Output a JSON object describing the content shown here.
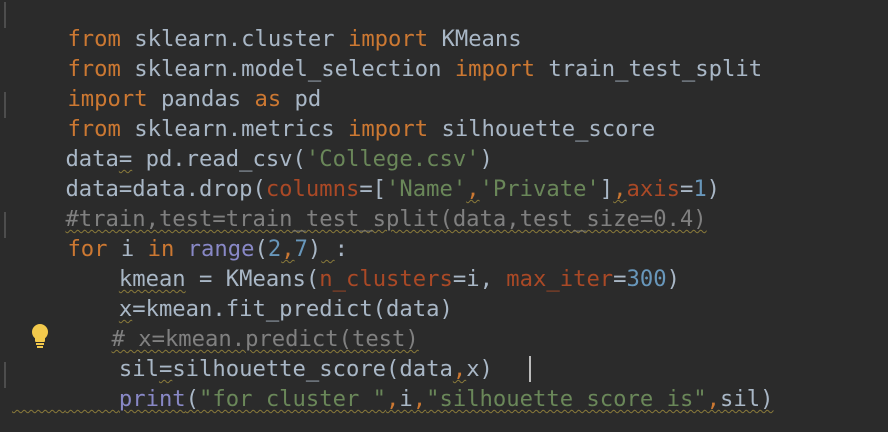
{
  "editor": {
    "lines": {
      "l1": {
        "kw1": "from",
        "mod": " sklearn.cluster ",
        "kw2": "import",
        "name": " KMeans"
      },
      "l2": {
        "kw1": "from",
        "mod": " sklearn.model_selection ",
        "kw2": "import",
        "name": " train_test_split"
      },
      "l3": {
        "kw1": "import",
        "mod": " pandas ",
        "kw2": "as",
        "name": " pd"
      },
      "l4": {
        "kw1": "from",
        "mod": " sklearn.metrics ",
        "kw2": "import",
        "name": " silhouette_score"
      },
      "l5": {
        "a": "data",
        "b": "=",
        "c": " pd.read_csv(",
        "s": "'College.csv'",
        "d": ")"
      },
      "l6": {
        "a": "data=data.drop(",
        "p1": "columns",
        "b": "=[",
        "s1": "'Name'",
        "comma1": ",",
        "s2": "'Private'",
        "c": "]",
        "comma2": ",",
        "p2": "axis",
        "d": "=",
        "n": "1",
        "e": ")"
      },
      "l7": {
        "text": "#train,test=train_test_split(data,test_size=0.4)"
      },
      "l8": {
        "kw": "for",
        "a": " i ",
        "kw2": "in",
        "b": " ",
        "builtin": "range",
        "c": "(",
        "n1": "2",
        "comma": ",",
        "n2": "7",
        "d": ")",
        "sp": " ",
        "e": ":"
      },
      "l9": {
        "indent": "    ",
        "a": "kmean",
        "b": " = KMeans(",
        "p1": "n_clusters",
        "c": "=i, ",
        "p2": "max_iter",
        "d": "=",
        "n": "300",
        "e": ")"
      },
      "l10": {
        "indent": "    ",
        "a": "x",
        "b": "=kmean.fit_predict(data)"
      },
      "l11": {
        "indent": "   ",
        "text": "# x=kmean.predict(test)"
      },
      "l12": {
        "indent": "    ",
        "a": "sil",
        "b": "=",
        "c": "silhouette_score(data",
        "comma": ",",
        "d": "x)"
      },
      "l13": {
        "indent": "    ",
        "builtin": "print",
        "a": "(",
        "s1": "\"for cluster \"",
        "comma1": ",",
        "b": "i",
        "comma2": ",",
        "s2a": "\"silhouett",
        "s2b": "e score is\"",
        "comma3": ",",
        "c": "sil)"
      }
    }
  }
}
